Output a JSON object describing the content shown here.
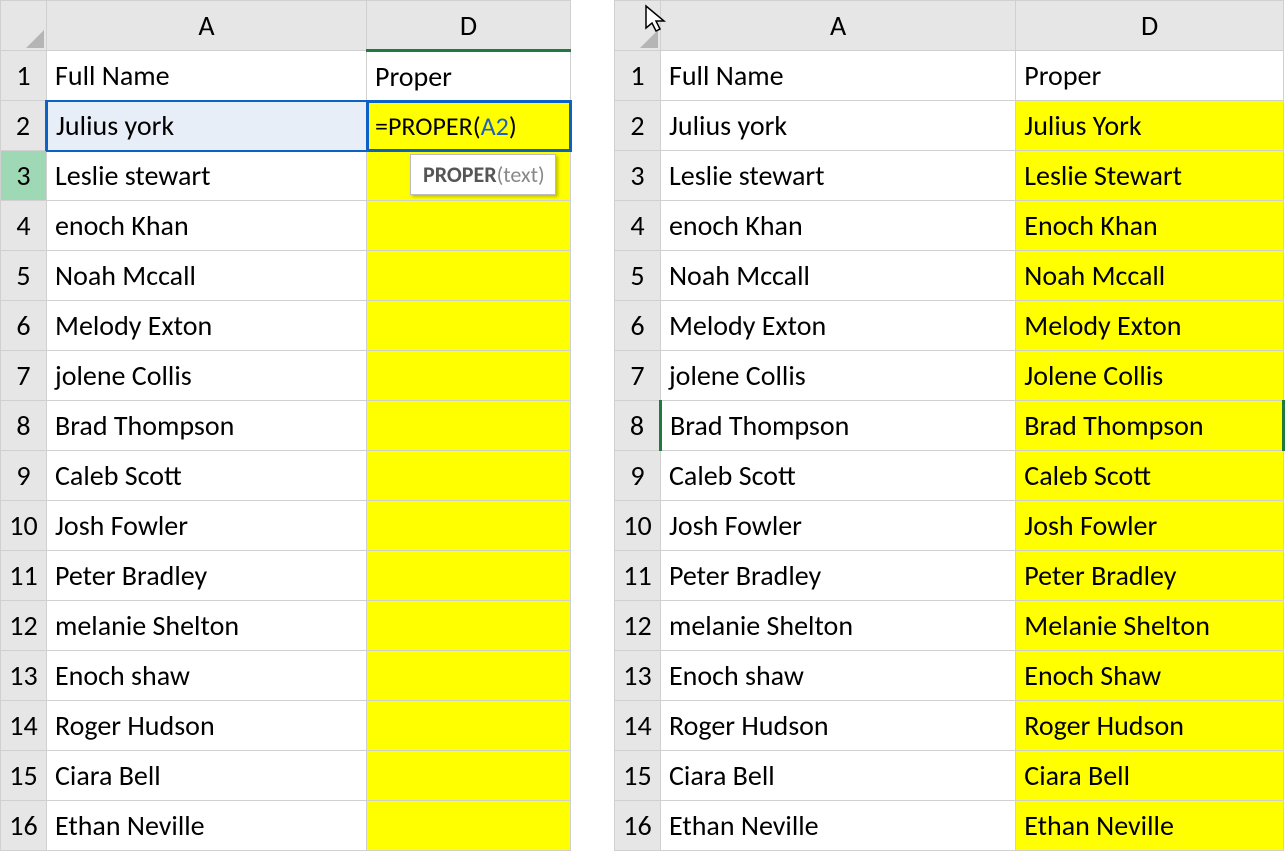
{
  "columns": {
    "A": "A",
    "D": "D"
  },
  "headers": {
    "fullName": "Full Name",
    "proper": "Proper"
  },
  "rows": [
    {
      "n": "1"
    },
    {
      "n": "2",
      "name": "Julius york",
      "proper": "Julius York"
    },
    {
      "n": "3",
      "name": "Leslie stewart",
      "proper": "Leslie Stewart"
    },
    {
      "n": "4",
      "name": "enoch Khan",
      "proper": "Enoch Khan"
    },
    {
      "n": "5",
      "name": "Noah Mccall",
      "proper": "Noah Mccall"
    },
    {
      "n": "6",
      "name": "Melody Exton",
      "proper": "Melody Exton"
    },
    {
      "n": "7",
      "name": "jolene Collis",
      "proper": "Jolene Collis"
    },
    {
      "n": "8",
      "name": "Brad Thompson",
      "proper": "Brad Thompson"
    },
    {
      "n": "9",
      "name": "Caleb Scott",
      "proper": "Caleb Scott"
    },
    {
      "n": "10",
      "name": "Josh Fowler",
      "proper": "Josh Fowler"
    },
    {
      "n": "11",
      "name": "Peter Bradley",
      "proper": "Peter Bradley"
    },
    {
      "n": "12",
      "name": "melanie Shelton",
      "proper": "Melanie Shelton"
    },
    {
      "n": "13",
      "name": "Enoch shaw",
      "proper": "Enoch Shaw"
    },
    {
      "n": "14",
      "name": "Roger Hudson",
      "proper": "Roger Hudson"
    },
    {
      "n": "15",
      "name": "Ciara Bell",
      "proper": "Ciara Bell"
    },
    {
      "n": "16",
      "name": "Ethan Neville",
      "proper": "Ethan Neville"
    }
  ],
  "formula": {
    "eq": "=",
    "fn": "PROPER",
    "open": "(",
    "ref": "A2",
    "close": ")"
  },
  "tooltip": {
    "fn": "PROPER",
    "sig": "(text)"
  }
}
